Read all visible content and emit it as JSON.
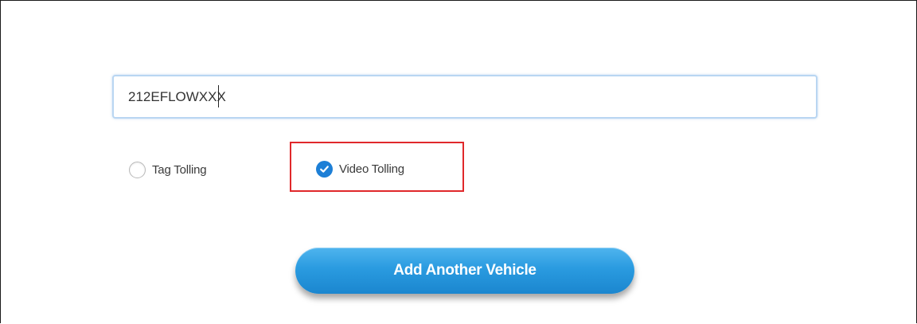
{
  "vehicle_form": {
    "plate_value": "212EFLOWXXX",
    "plate_placeholder": ""
  },
  "tolling_options": {
    "tag_label": "Tag Tolling",
    "video_label": "Video Tolling",
    "selected": "Video Tolling"
  },
  "actions": {
    "add_vehicle_label": "Add Another Vehicle"
  },
  "colors": {
    "accent": "#1d7fd6",
    "highlight": "#e0282b",
    "button_top": "#4fb4ee",
    "button_bottom": "#1b86cf"
  },
  "icons": {
    "unchecked": "radio-unchecked-icon",
    "checked": "check-circle-icon"
  }
}
